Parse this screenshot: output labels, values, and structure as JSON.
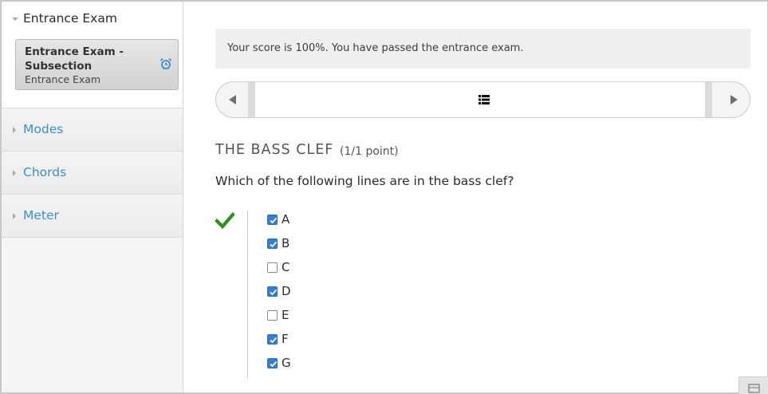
{
  "sidebar": {
    "open_chapter": "Entrance Exam",
    "subsection": {
      "title": "Entrance Exam - Subsection",
      "subtitle": "Entrance Exam"
    },
    "chapters": [
      "Modes",
      "Chords",
      "Meter"
    ]
  },
  "score": {
    "message": "Your score is 100%. You have passed the entrance exam."
  },
  "problem": {
    "title": "THE BASS CLEF",
    "points": "(1/1 point)",
    "question": "Which of the following lines are in the bass clef?",
    "status": "correct",
    "choices": [
      {
        "label": "A",
        "checked": true
      },
      {
        "label": "B",
        "checked": true
      },
      {
        "label": "C",
        "checked": false
      },
      {
        "label": "D",
        "checked": true
      },
      {
        "label": "E",
        "checked": false
      },
      {
        "label": "F",
        "checked": true
      },
      {
        "label": "G",
        "checked": true
      }
    ]
  },
  "colors": {
    "link": "#3a8fd0",
    "check": "#2c8f16",
    "checkbox": "#2f7ed8"
  },
  "icons": [
    "caret-down-icon",
    "alarm-clock-icon",
    "caret-right-icon",
    "previous-arrow-icon",
    "list-icon",
    "next-arrow-icon",
    "checkmark-icon",
    "checkbox-icon"
  ]
}
